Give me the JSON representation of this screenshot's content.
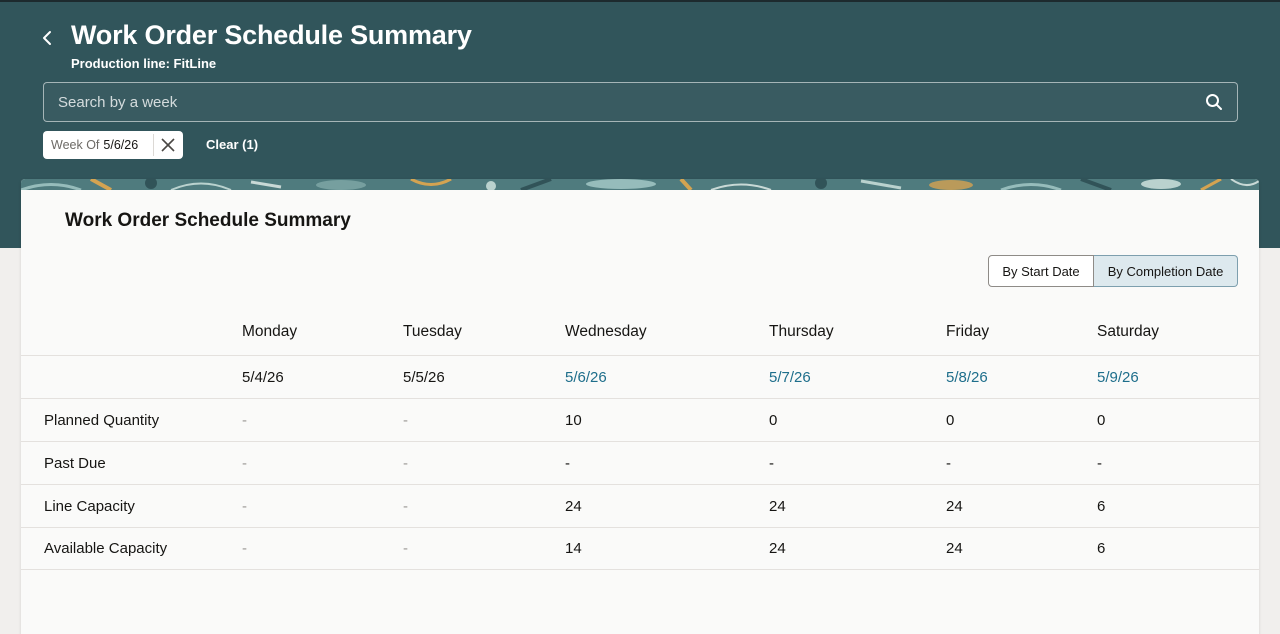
{
  "header": {
    "title": "Work Order Schedule Summary",
    "subtitle": "Production line: FitLine",
    "search_placeholder": "Search by a week",
    "filter_chip": {
      "label": "Week Of",
      "value": "5/6/26"
    },
    "clear_label": "Clear (1)"
  },
  "card": {
    "title": "Work Order Schedule Summary",
    "toggle": {
      "start": "By Start Date",
      "completion": "By Completion Date",
      "selected": "By Completion Date"
    }
  },
  "table": {
    "days": [
      "Monday",
      "Tuesday",
      "Wednesday",
      "Thursday",
      "Friday",
      "Saturday"
    ],
    "dates": [
      "5/4/26",
      "5/5/26",
      "5/6/26",
      "5/7/26",
      "5/8/26",
      "5/9/26"
    ],
    "rows": [
      {
        "label": "Planned Quantity",
        "values": [
          "-",
          "-",
          "10",
          "0",
          "0",
          "0"
        ]
      },
      {
        "label": "Past Due",
        "values": [
          "-",
          "-",
          "-",
          "-",
          "-",
          "-"
        ]
      },
      {
        "label": "Line Capacity",
        "values": [
          "-",
          "-",
          "24",
          "24",
          "24",
          "6"
        ]
      },
      {
        "label": "Available Capacity",
        "values": [
          "-",
          "-",
          "14",
          "24",
          "24",
          "6"
        ]
      }
    ]
  },
  "colors": {
    "header_bg": "#31555b",
    "link": "#1e6e8b",
    "toggle_selected": "#dde9ee"
  }
}
